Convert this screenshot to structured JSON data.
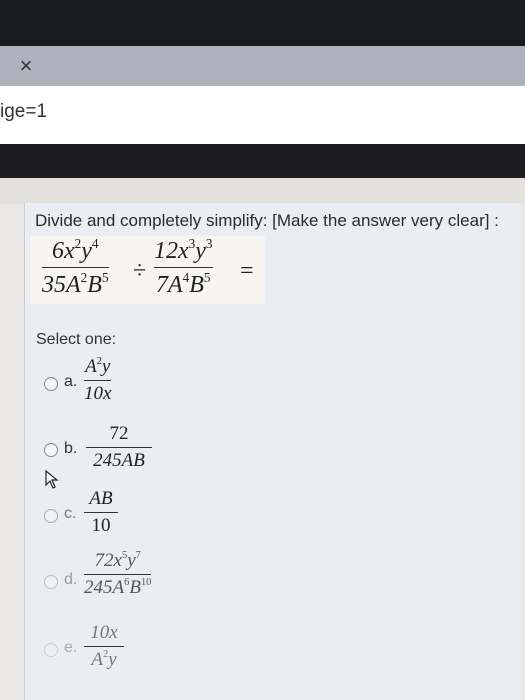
{
  "browser": {
    "tab_close_glyph": "×",
    "url_fragment": "ige=1"
  },
  "question": {
    "prompt": "Divide and completely simplify: [Make the answer very clear] :",
    "expression": {
      "left": {
        "num": "6x",
        "num_exp1": "2",
        "num_mid": "y",
        "num_exp2": "4",
        "den": "35A",
        "den_exp1": "2",
        "den_mid": "B",
        "den_exp2": "5"
      },
      "operator": "÷",
      "right": {
        "num": "12x",
        "num_exp1": "3",
        "num_mid": "y",
        "num_exp2": "3",
        "den": "7A",
        "den_exp1": "4",
        "den_mid": "B",
        "den_exp2": "5"
      },
      "equals": "="
    },
    "select_label": "Select one:",
    "options": [
      {
        "letter": "a.",
        "num": "A",
        "num_exp": "2",
        "num_tail": "y",
        "den": "10x",
        "den_exp": "",
        "den_tail": ""
      },
      {
        "letter": "b.",
        "num": "72",
        "num_exp": "",
        "num_tail": "",
        "den": "245AB",
        "den_exp": "",
        "den_tail": ""
      },
      {
        "letter": "c.",
        "num": "AB",
        "num_exp": "",
        "num_tail": "",
        "den": "10",
        "den_exp": "",
        "den_tail": ""
      },
      {
        "letter": "d.",
        "num": "72x",
        "num_exp": "5",
        "num_tail": "y",
        "num_exp2": "7",
        "den": "245A",
        "den_exp": "6",
        "den_tail": "B",
        "den_exp2": "10"
      },
      {
        "letter": "e.",
        "num": "10x",
        "num_exp": "",
        "num_tail": "",
        "den": "A",
        "den_exp": "2",
        "den_tail": "y"
      }
    ]
  },
  "colors": {
    "panel_bg": "#e9eef4",
    "formula_bg": "#f7f5f1",
    "tab_bar": "#aeb2bd",
    "top_bar": "#1a1b1d"
  }
}
